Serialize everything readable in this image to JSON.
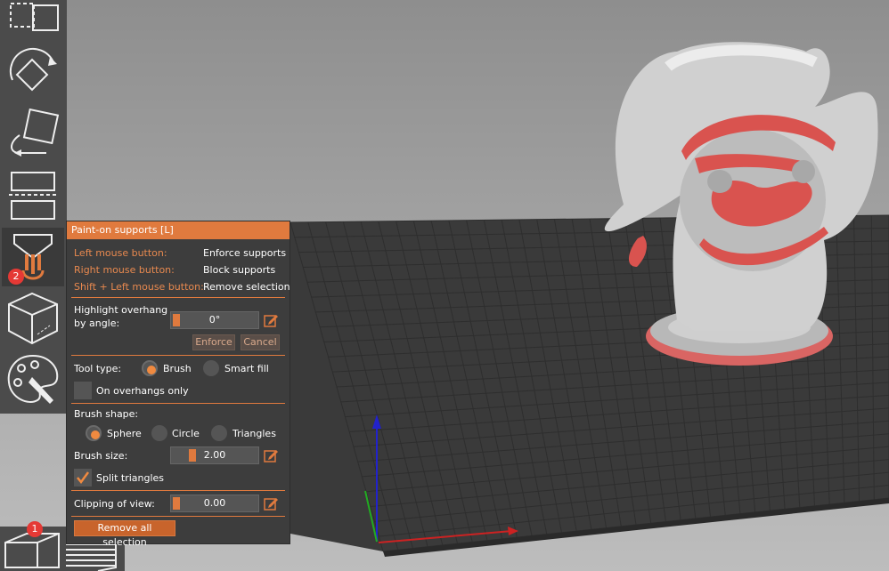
{
  "panel": {
    "title": "Paint-on supports [L]",
    "mouse": [
      {
        "key": "Left mouse button:",
        "action": "Enforce supports"
      },
      {
        "key": "Right mouse button:",
        "action": "Block supports"
      },
      {
        "key": "Shift + Left mouse button:",
        "action": "Remove selection"
      }
    ],
    "highlight_label_1": "Highlight overhang",
    "highlight_label_2": "by angle:",
    "angle_value": "0°",
    "enforce_label": "Enforce",
    "cancel_label": "Cancel",
    "tool_type_label": "Tool type:",
    "tool_brush": "Brush",
    "tool_smart_fill": "Smart fill",
    "on_overhangs_only": "On overhangs only",
    "brush_shape_label": "Brush shape:",
    "shape_sphere": "Sphere",
    "shape_circle": "Circle",
    "shape_triangles": "Triangles",
    "brush_size_label": "Brush size:",
    "brush_size_value": "2.00",
    "split_triangles": "Split triangles",
    "clipping_label": "Clipping of view:",
    "clipping_value": "0.00",
    "remove_all_label": "Remove all selection"
  },
  "badges": {
    "paint_supports": "2",
    "view": "1"
  },
  "colors": {
    "accent": "#e07a3e",
    "paint": "#d9534f",
    "panel": "#3d3d3d"
  }
}
